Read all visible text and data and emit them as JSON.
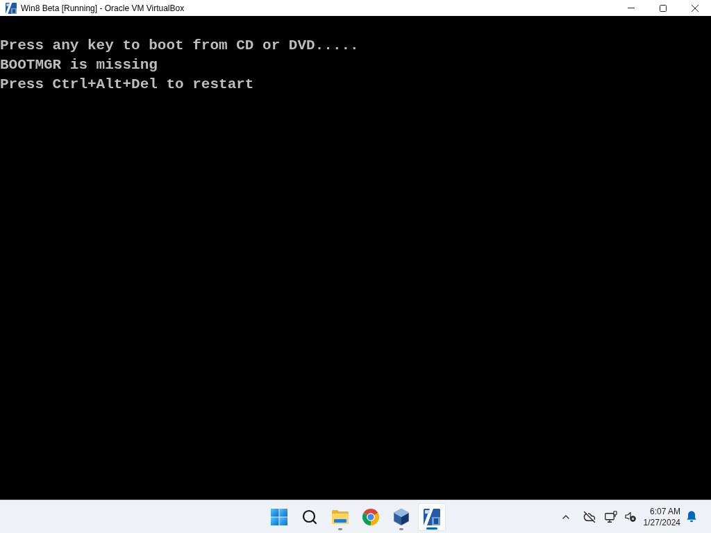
{
  "window": {
    "title": "Win8 Beta [Running] - Oracle VM VirtualBox"
  },
  "console": {
    "lines": [
      "Press any key to boot from CD or DVD.....",
      "BOOTMGR is missing",
      "Press Ctrl+Alt+Del to restart"
    ]
  },
  "taskbar": {
    "apps": [
      {
        "kind": "start",
        "running": false,
        "selected": false
      },
      {
        "kind": "search",
        "running": false,
        "selected": false
      },
      {
        "kind": "folder",
        "running": true,
        "selected": false
      },
      {
        "kind": "browser",
        "running": false,
        "selected": false
      },
      {
        "kind": "cube",
        "running": true,
        "selected": false
      },
      {
        "kind": "vm",
        "running": true,
        "selected": true
      }
    ]
  },
  "tray": {
    "clock": {
      "time": "6:07 AM",
      "date": "1/27/2024"
    }
  }
}
